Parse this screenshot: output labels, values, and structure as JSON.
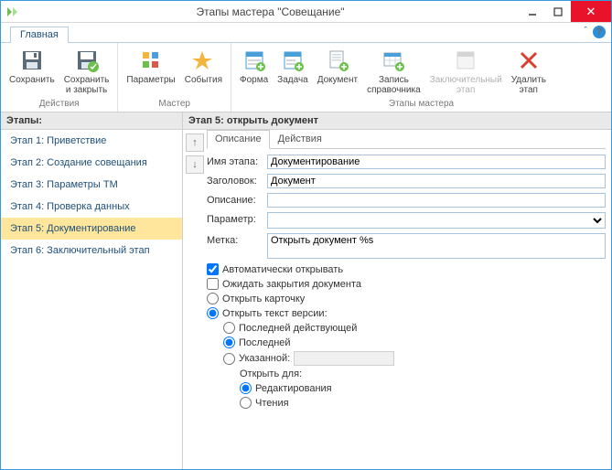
{
  "window": {
    "title": "Этапы мастера \"Совещание\""
  },
  "tabs": {
    "main": "Главная"
  },
  "ribbon": {
    "groups": {
      "actions": {
        "label": "Действия",
        "save": "Сохранить",
        "save_close": "Сохранить\nи закрыть"
      },
      "master": {
        "label": "Мастер",
        "params": "Параметры",
        "events": "События"
      },
      "wizard": {
        "label": "Этапы мастера",
        "form": "Форма",
        "task": "Задача",
        "document": "Документ",
        "ref": "Запись\nсправочника",
        "final": "Заключительный\nэтап",
        "delete": "Удалить\nэтап"
      }
    }
  },
  "sidebar": {
    "title": "Этапы:",
    "items": [
      "Этап 1: Приветствие",
      "Этап 2: Создание совещания",
      "Этап 3: Параметры ТМ",
      "Этап 4: Проверка данных",
      "Этап 5: Документирование",
      "Этап 6: Заключительный этап"
    ]
  },
  "main": {
    "title": "Этап 5: открыть документ",
    "tabs": {
      "desc": "Описание",
      "actions": "Действия"
    },
    "labels": {
      "name": "Имя этапа:",
      "header": "Заголовок:",
      "desc": "Описание:",
      "param": "Параметр:",
      "mark": "Метка:"
    },
    "values": {
      "name": "Документирование",
      "header": "Документ",
      "desc": "",
      "mark": "Открыть документ %s"
    },
    "opts": {
      "auto_open": "Автоматически открывать",
      "wait_close": "Ожидать закрытия документа",
      "open_card": "Открыть карточку",
      "open_text": "Открыть текст версии:",
      "last_valid": "Последней действующей",
      "last": "Последней",
      "specified": "Указанной:",
      "open_for": "Открыть для:",
      "edit": "Редактирования",
      "read": "Чтения"
    }
  }
}
